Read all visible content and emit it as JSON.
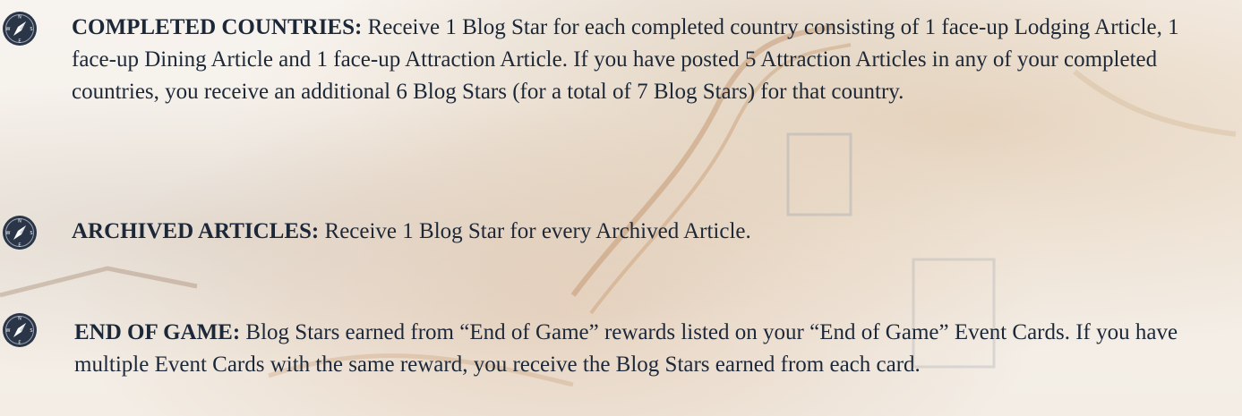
{
  "entries": [
    {
      "icon": "compass-icon",
      "heading": "COMPLETED COUNTRIES:",
      "body": "Receive 1 Blog Star for each completed country consisting of 1 face-up Lodging Article, 1 face-up Dining Article and 1 face-up Attraction Article. If you have posted 5 Attraction Articles in any of your completed countries, you receive an additional 6 Blog Stars (for a total of 7 Blog Stars) for that country."
    },
    {
      "icon": "compass-icon",
      "heading": "ARCHIVED ARTICLES:",
      "body": "Receive 1 Blog Star for every Archived Article."
    },
    {
      "icon": "compass-icon",
      "heading": "END OF GAME:",
      "body": "Blog Stars earned from “End of Game” rewards listed on your “End of Game” Event Cards. If you have multiple Event Cards with the same reward, you receive the Blog Stars earned from each card."
    }
  ],
  "compass_letters": [
    "N",
    "E",
    "S",
    "W"
  ],
  "colors": {
    "text": "#1c2838",
    "icon_fill": "#2a3548",
    "icon_needle": "#ffffff"
  }
}
